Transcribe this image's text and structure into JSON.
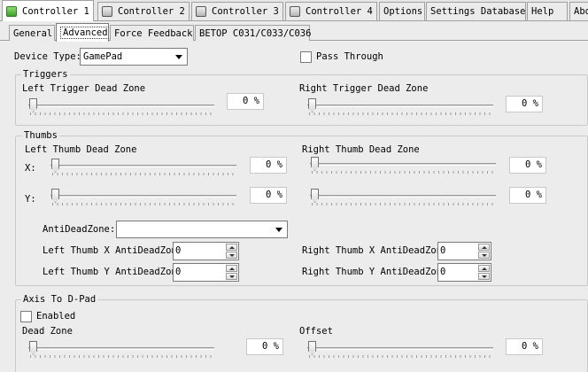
{
  "top_tabs": [
    {
      "label": "Controller 1",
      "active": true
    },
    {
      "label": "Controller 2"
    },
    {
      "label": "Controller 3"
    },
    {
      "label": "Controller 4"
    },
    {
      "label": "Options"
    },
    {
      "label": "Settings Database"
    },
    {
      "label": "Help"
    },
    {
      "label": "Abo"
    }
  ],
  "sub_tabs": [
    {
      "label": "General"
    },
    {
      "label": "Advanced",
      "active": true
    },
    {
      "label": "Force Feedback"
    },
    {
      "label": "BETOP C031/C033/C036"
    }
  ],
  "device_type": {
    "label": "Device Type:",
    "value": "GamePad"
  },
  "pass_through": {
    "label": "Pass Through",
    "checked": false
  },
  "triggers": {
    "title": "Triggers",
    "left": {
      "label": "Left Trigger Dead Zone",
      "value": "0 %",
      "level": 0
    },
    "right": {
      "label": "Right Trigger Dead Zone",
      "value": "0 %",
      "level": 0
    }
  },
  "thumbs": {
    "title": "Thumbs",
    "left_label": "Left Thumb Dead Zone",
    "right_label": "Right Thumb Dead Zone",
    "x_label": "X:",
    "y_label": "Y:",
    "left_x": {
      "value": "0 %",
      "level": 0
    },
    "left_y": {
      "value": "0 %",
      "level": 0
    },
    "right_x": {
      "value": "0 %",
      "level": 0
    },
    "right_y": {
      "value": "0 %",
      "level": 0
    },
    "anti_dead_zone": {
      "label": "AntiDeadZone:",
      "value": ""
    },
    "left_x_anti": {
      "label": "Left Thumb X AntiDeadZone",
      "value": "0"
    },
    "left_y_anti": {
      "label": "Left Thumb Y AntiDeadZone",
      "value": "0"
    },
    "right_x_anti": {
      "label": "Right Thumb X AntiDeadZone",
      "value": "0"
    },
    "right_y_anti": {
      "label": "Right Thumb Y AntiDeadZone",
      "value": "0"
    }
  },
  "axis_to_dpad": {
    "title": "Axis To D-Pad",
    "enabled": {
      "label": "Enabled",
      "checked": false
    },
    "dead_zone": {
      "label": "Dead Zone",
      "value": "0 %",
      "level": 0
    },
    "offset": {
      "label": "Offset",
      "value": "0 %",
      "level": 0
    }
  },
  "icons": {
    "controller_active": "gamepad-green-icon",
    "controller_inactive": "gamepad-gray-icon"
  }
}
